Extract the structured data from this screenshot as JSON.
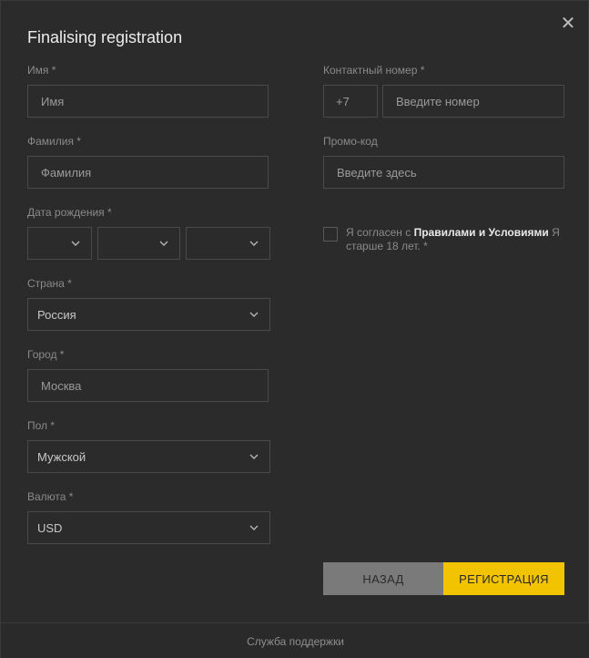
{
  "modal": {
    "title": "Finalising registration",
    "close_icon": "close-icon"
  },
  "left": {
    "first_name": {
      "label": "Имя *",
      "placeholder": "Имя"
    },
    "last_name": {
      "label": "Фамилия *",
      "placeholder": "Фамилия"
    },
    "birthdate": {
      "label": "Дата рождения *",
      "day": "",
      "month": "",
      "year": ""
    },
    "country": {
      "label": "Страна *",
      "value": "Россия"
    },
    "city": {
      "label": "Город *",
      "placeholder": "Москва"
    },
    "gender": {
      "label": "Пол *",
      "value": "Мужской"
    },
    "currency": {
      "label": "Валюта *",
      "value": "USD"
    }
  },
  "right": {
    "phone": {
      "label": "Контактный номер *",
      "code": "+7",
      "placeholder": "Введите номер"
    },
    "promo": {
      "label": "Промо-код",
      "placeholder": "Введите здесь"
    },
    "agree": {
      "prefix": "Я согласен с ",
      "link": "Правилами и Условиями",
      "suffix": " Я старше 18 лет. *"
    }
  },
  "buttons": {
    "back": "НАЗАД",
    "register": "РЕГИСТРАЦИЯ"
  },
  "footer": {
    "support": "Служба поддержки"
  },
  "colors": {
    "background": "#2b2b2b",
    "accent": "#f2c300",
    "back_button": "#7a7a7a"
  }
}
